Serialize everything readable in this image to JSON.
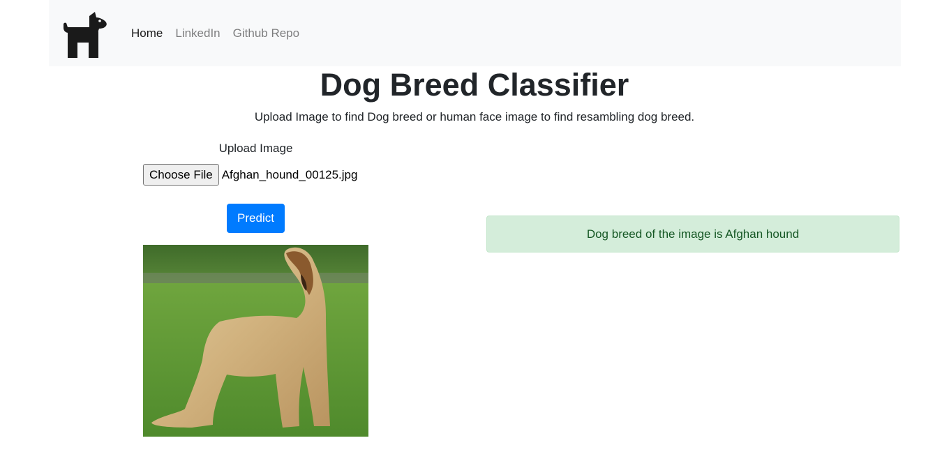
{
  "nav": {
    "logo_icon": "dog-icon",
    "items": [
      {
        "label": "Home",
        "active": true
      },
      {
        "label": "LinkedIn",
        "active": false
      },
      {
        "label": "Github Repo",
        "active": false
      }
    ]
  },
  "main": {
    "title": "Dog Breed Classifier",
    "subtitle": "Upload Image to find Dog breed or human face image to find resambling dog breed.",
    "upload_label": "Upload Image",
    "file_button_label": "Choose File",
    "file_name": "Afghan_hound_00125.jpg",
    "predict_label": "Predict",
    "preview_alt": "Afghan hound photo"
  },
  "result": {
    "message": "Dog breed of the image is Afghan hound"
  },
  "colors": {
    "primary": "#007bff",
    "success_bg": "#d4edda",
    "success_text": "#155724",
    "navbar_bg": "#f8f9fa"
  }
}
